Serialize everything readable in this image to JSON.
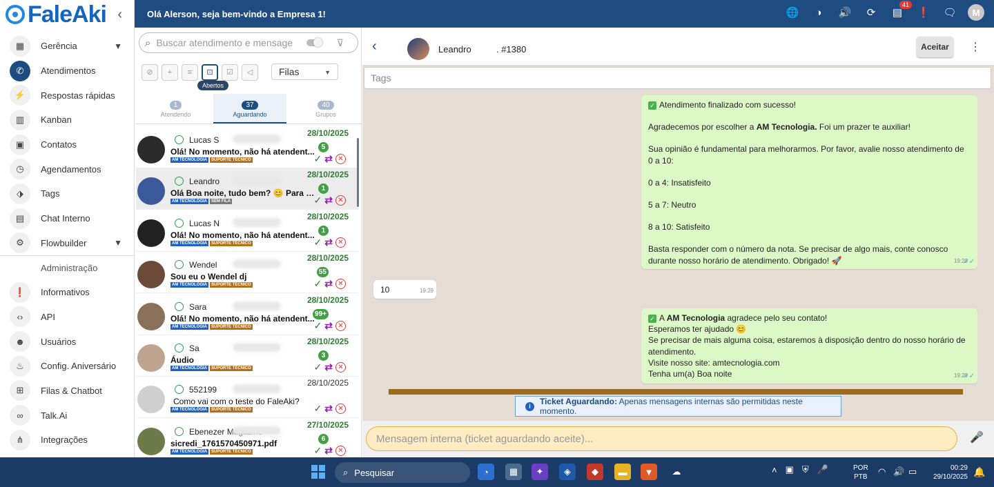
{
  "app": {
    "logo": "FaleAki",
    "greeting": "Olá Alerson, seja bem-vindo a Empresa 1!",
    "notification_count": "41",
    "avatar_letter": "M"
  },
  "sidebar": {
    "items": [
      {
        "label": "Gerência",
        "icon": "dashboard-icon",
        "chevron": true
      },
      {
        "label": "Atendimentos",
        "icon": "whatsapp-icon",
        "active": true
      },
      {
        "label": "Respostas rápidas",
        "icon": "flash-icon"
      },
      {
        "label": "Kanban",
        "icon": "kanban-icon"
      },
      {
        "label": "Contatos",
        "icon": "contacts-icon"
      },
      {
        "label": "Agendamentos",
        "icon": "clock-icon"
      },
      {
        "label": "Tags",
        "icon": "tag-icon"
      },
      {
        "label": "Chat Interno",
        "icon": "chat-icon"
      },
      {
        "label": "Flowbuilder",
        "icon": "flow-icon",
        "chevron": true
      }
    ],
    "admin_title": "Administração",
    "admin_items": [
      {
        "label": "Informativos",
        "icon": "announcement-icon"
      },
      {
        "label": "API",
        "icon": "code-icon"
      },
      {
        "label": "Usuários",
        "icon": "users-icon"
      },
      {
        "label": "Config. Aniversário",
        "icon": "cake-icon"
      },
      {
        "label": "Filas & Chatbot",
        "icon": "queue-icon"
      },
      {
        "label": "Talk.Ai",
        "icon": "infinity-icon"
      },
      {
        "label": "Integrações",
        "icon": "integrations-icon"
      }
    ]
  },
  "tickets": {
    "search_placeholder": "Buscar atendimento e mensage",
    "filas_label": "Filas",
    "abertos_tooltip": "Abertos",
    "tabs": [
      {
        "count": "1",
        "label": "Atendendo"
      },
      {
        "count": "37",
        "label": "Aguardando",
        "active": true
      },
      {
        "count": "40",
        "label": "Grupos"
      }
    ],
    "rows": [
      {
        "name": "Lucas S",
        "message": "Olá! No momento, não há atendent...",
        "date": "28/10/2025",
        "unread": "5",
        "tag1": "AM TECNOLOGIA",
        "tag2": "SUPORTE TÉCNICO"
      },
      {
        "name": "Leandro",
        "message": "Olá Boa noite, tudo bem? 😊 Para q...",
        "date": "28/10/2025",
        "unread": "1",
        "tag1": "AM TECNOLOGIA",
        "tag2": "SEM FILA",
        "selected": true
      },
      {
        "name": "Lucas N",
        "message": "Olá! No momento, não há atendent...",
        "date": "28/10/2025",
        "unread": "1",
        "tag1": "AM TECNOLOGIA",
        "tag2": "SUPORTE TÉCNICO"
      },
      {
        "name": "Wendel",
        "message": "Sou eu o Wendel dj",
        "date": "28/10/2025",
        "unread": "55",
        "tag1": "AM TECNOLOGIA",
        "tag2": "SUPORTE TÉCNICO"
      },
      {
        "name": "Sara",
        "message": "Olá! No momento, não há atendent...",
        "date": "28/10/2025",
        "unread": "99+",
        "tag1": "AM TECNOLOGIA",
        "tag2": "SUPORTE TÉCNICO"
      },
      {
        "name": "Sa",
        "message": "Áudio",
        "date": "28/10/2025",
        "unread": "3",
        "tag1": "AM TECNOLOGIA",
        "tag2": "SUPORTE TÉCNICO"
      },
      {
        "name": "552199",
        "message": "Como vai com o teste do FaleAki?",
        "date": "28/10/2025",
        "unread": "",
        "tag1": "AM TECNOLOGIA",
        "tag2": "SUPORTE TÉCNICO",
        "plain": true
      },
      {
        "name": "Ebenezer Magazine",
        "message": "sicredi_1761570450971.pdf",
        "date": "27/10/2025",
        "unread": "6",
        "tag1": "AM TECNOLOGIA",
        "tag2": "SUPORTE TÉCNICO"
      }
    ]
  },
  "chat": {
    "contact_name": "Leandro",
    "ticket_id": ". #1380",
    "accept_label": "Aceitar",
    "tags_placeholder": "Tags",
    "msg1": {
      "line1": "Atendimento finalizado com sucesso!",
      "line2_pre": "Agradecemos por escolher a ",
      "line2_bold": "AM Tecnologia.",
      "line2_post": " Foi um prazer te auxiliar!",
      "line3": "Sua opinião é fundamental para melhorarmos. Por favor, avalie nosso atendimento de 0 a 10:",
      "line4": "0 a 4: Insatisfeito",
      "line5": "5 a 7: Neutro",
      "line6": "8 a 10: Satisfeito",
      "line7": "Basta responder com o número da nota. Se precisar de algo mais, conte conosco durante nosso horário de atendimento. Obrigado! 🚀",
      "time": "19:29"
    },
    "msg2": {
      "text": "10",
      "time": "19:29"
    },
    "msg3": {
      "l1_pre": "A ",
      "l1_bold": "AM Tecnologia",
      "l1_post": " agradece pelo seu contato!",
      "l2": "Esperamos ter ajudado 😊",
      "l3": "Se precisar de mais alguma coisa, estaremos à disposição dentro do nosso horário de atendimento.",
      "l4": "Visite nosso site: amtecnologia.com",
      "l5": "Tenha um(a) Boa noite",
      "time": "19:29"
    },
    "notice_bold": "Ticket Aguardando:",
    "notice_text": "Apenas mensagens internas são permitidas neste momento.",
    "composer_placeholder": "Mensagem interna (ticket aguardando aceite)..."
  },
  "taskbar": {
    "search": "Pesquisar",
    "lang1": "POR",
    "lang2": "PTB",
    "time": "00:29",
    "date": "29/10/2025"
  }
}
